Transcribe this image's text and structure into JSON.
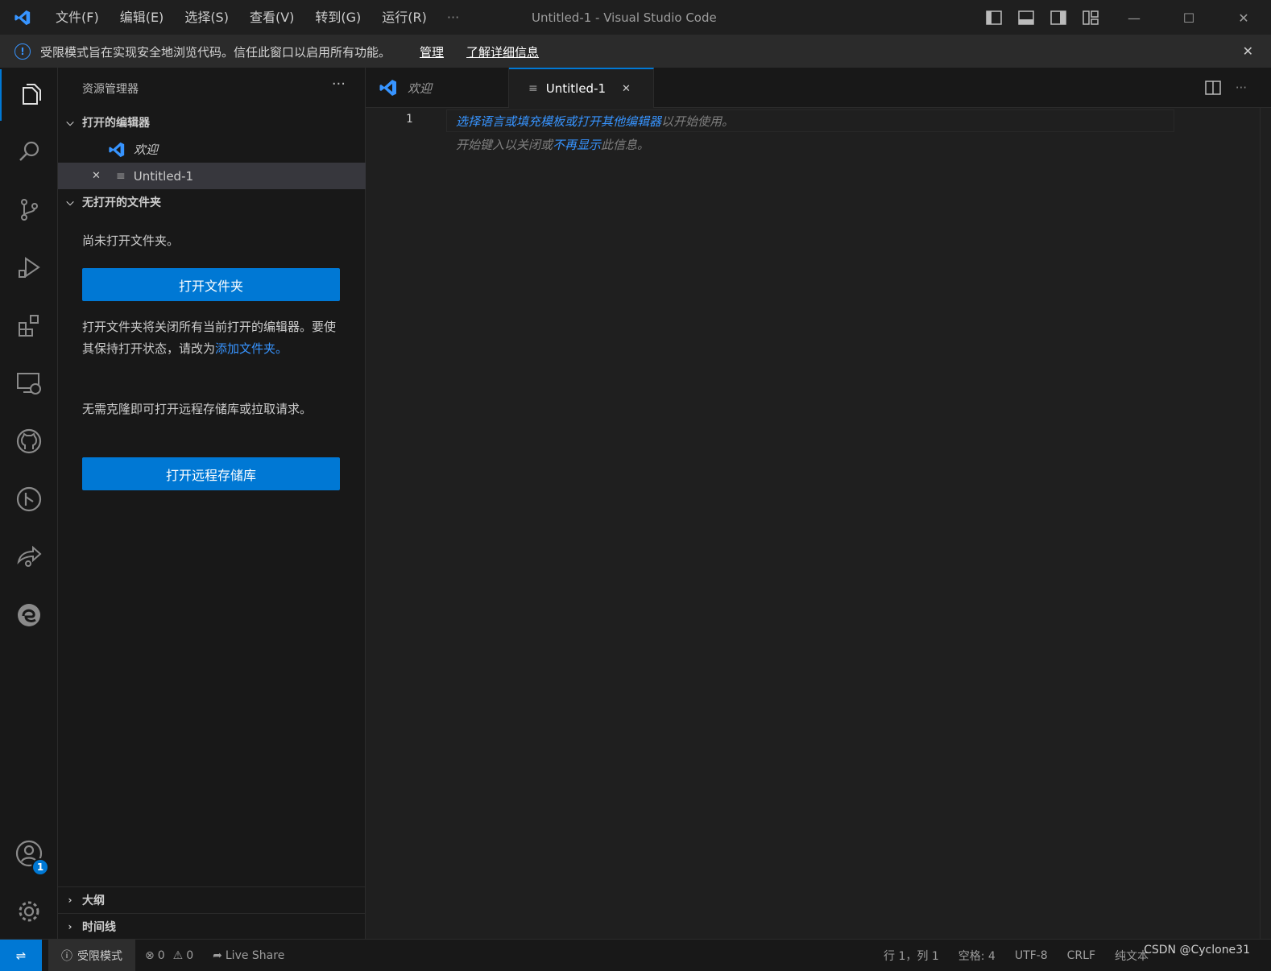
{
  "titlebar": {
    "menu": [
      "文件(F)",
      "编辑(E)",
      "选择(S)",
      "查看(V)",
      "转到(G)",
      "运行(R)"
    ],
    "more": "···",
    "window_title": "Untitled-1 - Visual Studio Code",
    "controls": {
      "minimize": "—",
      "maximize": "☐",
      "close": "✕"
    }
  },
  "banner": {
    "text": "受限模式旨在实现安全地浏览代码。信任此窗口以启用所有功能。",
    "manage": "管理",
    "learn_more": "了解详细信息",
    "close": "✕"
  },
  "activity": {
    "accounts_badge": "1"
  },
  "sidebar": {
    "title": "资源管理器",
    "more": "···",
    "open_editors": {
      "label": "打开的编辑器",
      "items": [
        {
          "name": "欢迎",
          "close": ""
        },
        {
          "name": "Untitled-1",
          "close": "✕"
        }
      ]
    },
    "no_folder": {
      "label": "无打开的文件夹",
      "message": "尚未打开文件夹。",
      "open_folder_button": "打开文件夹",
      "info_text": "打开文件夹将关闭所有当前打开的编辑器。要使其保持打开状态，请改为",
      "add_folder_link": "添加文件夹。",
      "remote_text": "无需克隆即可打开远程存储库或拉取请求。",
      "open_remote_button": "打开远程存储库"
    },
    "outline": "大纲",
    "timeline": "时间线"
  },
  "tabs": [
    {
      "label": "欢迎"
    },
    {
      "label": "Untitled-1",
      "close": "✕"
    }
  ],
  "editor": {
    "line_number": "1",
    "hint_line1_link": "选择语言或填充模板或打开其他编辑器",
    "hint_line1_rest": "以开始使用。",
    "hint_line2_pre": "开始键入以关闭或",
    "hint_line2_link": "不再显示",
    "hint_line2_post": "此信息。"
  },
  "statusbar": {
    "remote": "⇌",
    "restricted": "受限模式",
    "errors": "0",
    "warnings": "0",
    "live_share": "Live Share",
    "position": "行 1，列 1",
    "spaces": "空格: 4",
    "encoding": "UTF-8",
    "eol": "CRLF",
    "language": "纯文本"
  },
  "watermark": "CSDN @Cyclone31",
  "colors": {
    "accent": "#0078d4",
    "link": "#3794ff",
    "background": "#1f1f1f",
    "sidebar": "#181818"
  }
}
